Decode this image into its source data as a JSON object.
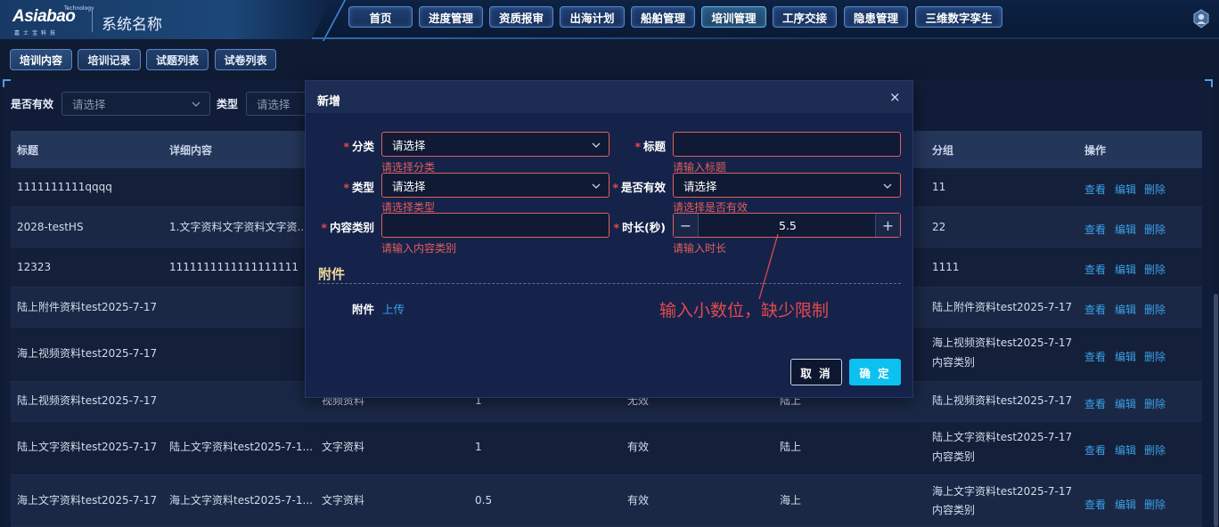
{
  "header": {
    "logo_text": "Asiabao",
    "logo_tech": "Technology",
    "logo_sub": "嘉士宝科技",
    "system_name": "系统名称",
    "nav": [
      {
        "label": "首页"
      },
      {
        "label": "进度管理"
      },
      {
        "label": "资质报审"
      },
      {
        "label": "出海计划"
      },
      {
        "label": "船舶管理"
      },
      {
        "label": "培训管理",
        "active": true
      },
      {
        "label": "工序交接"
      },
      {
        "label": "隐患管理"
      },
      {
        "label": "三维数字孪生"
      }
    ],
    "user_icon": "user-avatar-icon"
  },
  "subtabs": [
    {
      "label": "培训内容",
      "active": true
    },
    {
      "label": "培训记录"
    },
    {
      "label": "试题列表"
    },
    {
      "label": "试卷列表"
    }
  ],
  "filters": {
    "valid_label": "是否有效",
    "valid_placeholder": "请选择",
    "type_label": "类型",
    "type_placeholder": "请选择"
  },
  "table": {
    "columns": [
      "标题",
      "详细内容",
      "分组",
      "操作"
    ],
    "rows": [
      {
        "title": "1111111111qqqq",
        "detail": "",
        "type": "",
        "duration": "",
        "valid": "",
        "category": "",
        "group": [
          "11"
        ]
      },
      {
        "title": "2028-testHS",
        "detail": "1.文字资料文字资料文字资...",
        "type": "",
        "duration": "",
        "valid": "",
        "category": "",
        "group": [
          "22"
        ]
      },
      {
        "title": "12323",
        "detail": "1111111111111111111",
        "type": "",
        "duration": "",
        "valid": "",
        "category": "",
        "group": [
          "1111"
        ]
      },
      {
        "title": "陆上附件资料test2025-7-17",
        "detail": "",
        "type": "",
        "duration": "",
        "valid": "",
        "category": "",
        "group": [
          "陆上附件资料test2025-7-17"
        ]
      },
      {
        "title": "海上视频资料test2025-7-17",
        "detail": "",
        "type": "",
        "duration": "",
        "valid": "",
        "category": "",
        "group": [
          "海上视频资料test2025-7-17",
          "内容类别"
        ]
      },
      {
        "title": "陆上视频资料test2025-7-17",
        "detail": "",
        "type": "视频资料",
        "duration": "1",
        "valid": "无效",
        "category": "陆上",
        "group": [
          "陆上视频资料test2025-7-17"
        ]
      },
      {
        "title": "陆上文字资料test2025-7-17",
        "detail": "陆上文字资料test2025-7-1...",
        "type": "文字资料",
        "duration": "1",
        "valid": "有效",
        "category": "陆上",
        "group": [
          "陆上文字资料test2025-7-17",
          "内容类别"
        ]
      },
      {
        "title": "海上文字资料test2025-7-17",
        "detail": "海上文字资料test2025-7-1...",
        "type": "文字资料",
        "duration": "0.5",
        "valid": "有效",
        "category": "海上",
        "group": [
          "海上文字资料test2025-7-17",
          "内容类别"
        ]
      }
    ],
    "ops": {
      "view": "查看",
      "edit": "编辑",
      "delete": "删除"
    }
  },
  "modal": {
    "title": "新增",
    "close": "×",
    "category_label": "分类",
    "category_placeholder": "请选择",
    "category_error": "请选择分类",
    "title_label": "标题",
    "title_value": "",
    "title_error": "请输入标题",
    "type_label": "类型",
    "type_placeholder": "请选择",
    "type_error": "请选择类型",
    "valid_label": "是否有效",
    "valid_placeholder": "请选择",
    "valid_error": "请选择是否有效",
    "content_category_label": "内容类别",
    "content_category_value": "",
    "content_category_error": "请输入内容类别",
    "duration_label": "时长(秒)",
    "duration_value": "5.5",
    "duration_minus": "−",
    "duration_plus": "+",
    "duration_error": "请输入时长",
    "attachment_section": "附件",
    "attachment_label": "附件",
    "upload_link": "上传",
    "cancel_button": "取 消",
    "ok_button": "确 定",
    "required_mark": "*"
  },
  "annotation": {
    "text": "输入小数位，缺少限制",
    "color": "#e4484f"
  }
}
